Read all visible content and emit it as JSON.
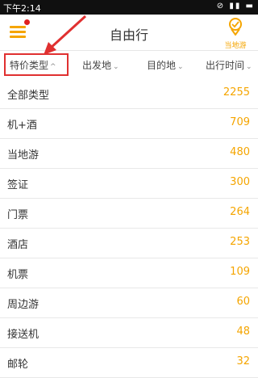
{
  "status_bar": {
    "time": "下午2:14",
    "icons": "⊘ ▮▮ ▬"
  },
  "header": {
    "title": "自由行",
    "local_label": "当地游"
  },
  "filters": [
    {
      "label": "特价类型",
      "chevron": "^"
    },
    {
      "label": "出发地",
      "chevron": "⌄"
    },
    {
      "label": "目的地",
      "chevron": "⌄"
    },
    {
      "label": "出行时间",
      "chevron": "⌄"
    }
  ],
  "list": [
    {
      "name": "全部类型",
      "count": "2255"
    },
    {
      "name": "机+酒",
      "count": "709"
    },
    {
      "name": "当地游",
      "count": "480"
    },
    {
      "name": "签证",
      "count": "300"
    },
    {
      "name": "门票",
      "count": "264"
    },
    {
      "name": "酒店",
      "count": "253"
    },
    {
      "name": "机票",
      "count": "109"
    },
    {
      "name": "周边游",
      "count": "60"
    },
    {
      "name": "接送机",
      "count": "48"
    },
    {
      "name": "邮轮",
      "count": "32"
    }
  ],
  "colors": {
    "accent": "#f5a500",
    "highlight": "#e03030"
  }
}
